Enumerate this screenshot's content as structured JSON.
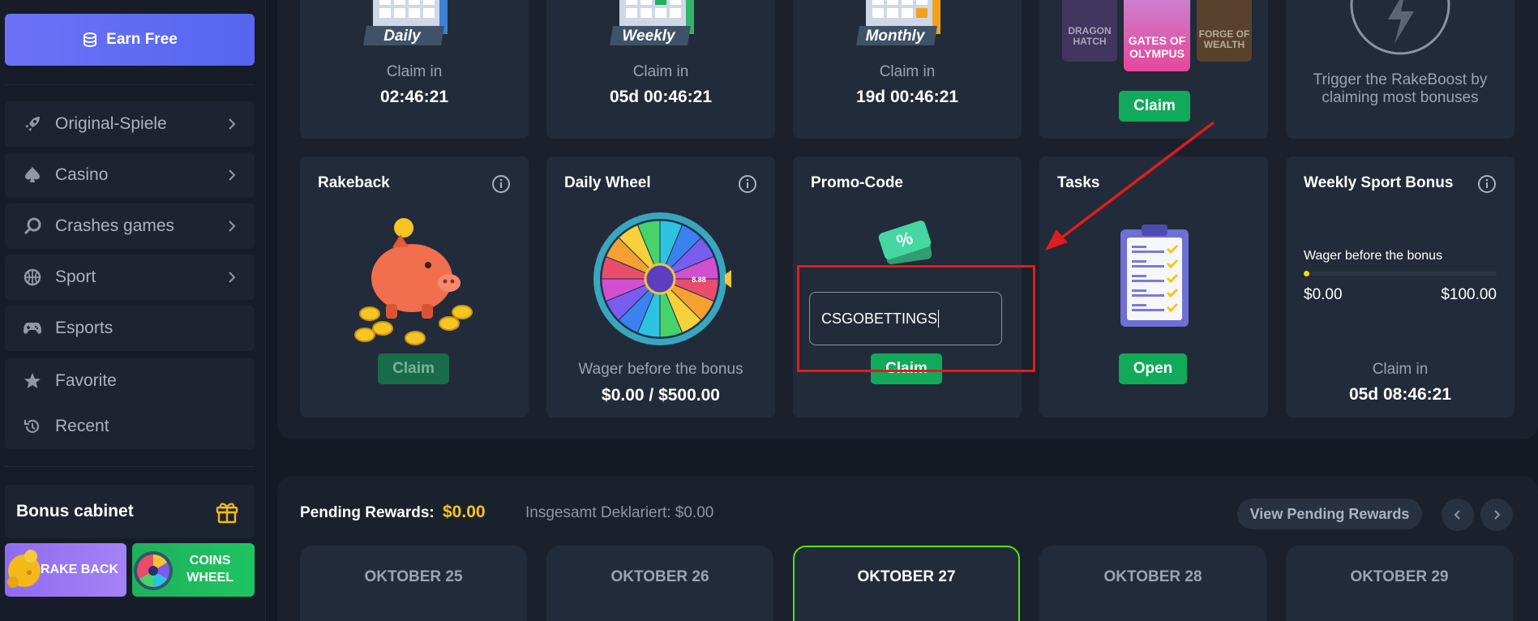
{
  "sidebar": {
    "earn_free": "Earn Free",
    "items": [
      {
        "label": "Original-Spiele",
        "icon": "rocket-icon"
      },
      {
        "label": "Casino",
        "icon": "spade-icon"
      },
      {
        "label": "Crashes games",
        "icon": "crash-icon"
      },
      {
        "label": "Sport",
        "icon": "basketball-icon"
      },
      {
        "label": "Esports",
        "icon": "gamepad-icon"
      }
    ],
    "favorite": "Favorite",
    "recent": "Recent",
    "bonus_cabinet": "Bonus cabinet",
    "rake_back": "RAKE BACK",
    "coins_wheel_1": "COINS",
    "coins_wheel_2": "WHEEL"
  },
  "top_row": {
    "daily": {
      "badge": "Daily",
      "claim_in": "Claim in",
      "time": "02:46:21"
    },
    "weekly": {
      "badge": "Weekly",
      "claim_in": "Claim in",
      "time": "05d 00:46:21"
    },
    "monthly": {
      "badge": "Monthly",
      "claim_in": "Claim in",
      "time": "19d 00:46:21"
    },
    "slots": {
      "game_left": "DRAGON HATCH",
      "game_center": "GATES OF OLYMPUS",
      "game_right": "FORGE OF WEALTH",
      "claim": "Claim"
    },
    "rakeboost": {
      "text_1": "Trigger the RakeBoost by",
      "text_2": "claiming most bonuses"
    }
  },
  "cards": {
    "rakeback": {
      "title": "Rakeback",
      "claim": "Claim"
    },
    "daily_wheel": {
      "title": "Daily Wheel",
      "wheel_center": "8.88",
      "wager_label": "Wager before the bonus",
      "wager_value": "$0.00 / $500.00"
    },
    "promo_code": {
      "title": "Promo-Code",
      "input_value": "CSGOBETTINGS",
      "claim": "Claim"
    },
    "tasks": {
      "title": "Tasks",
      "open": "Open"
    },
    "weekly_sport": {
      "title": "Weekly Sport Bonus",
      "wager_label": "Wager before the bonus",
      "min": "$0.00",
      "max": "$100.00",
      "progress": 0,
      "claim_in": "Claim in",
      "time": "05d 08:46:21"
    }
  },
  "pending": {
    "label": "Pending Rewards:",
    "amount": "$0.00",
    "total": "Insgesamt Deklariert: $0.00",
    "view_button": "View Pending Rewards",
    "days": [
      "OKTOBER 25",
      "OKTOBER 26",
      "OKTOBER 27",
      "OKTOBER 28",
      "OKTOBER 29"
    ],
    "active_day": "OKTOBER 27"
  },
  "colors": {
    "accent_purple": "#5a68f2",
    "claim_green": "#11a95a",
    "gold": "#f5c518",
    "highlight_red": "#e01c1c",
    "active_border": "#56e10f"
  }
}
